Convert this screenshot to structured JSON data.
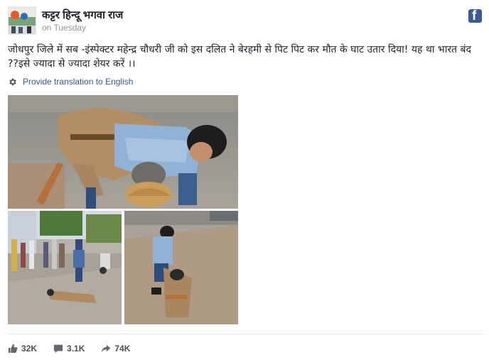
{
  "post": {
    "page_name": "कट्टर हिन्दू भगवा राज",
    "timestamp": "on Tuesday",
    "text": "जोधपुर जिले में सब -इंस्पेक्टर महेन्द्र चौधरी जी को इस दलित ने बेरहमी से पिट पिट कर मौत के घाट उतार दिया! यह था भारत बंद ??इसे ज्यादा से ज्यादा शेयर करें ।।",
    "translate_label": "Provide translation to English",
    "platform_icon": "facebook-logo-icon",
    "brand_color": "#3b5998",
    "link_color": "#365899"
  },
  "stats": {
    "likes": "32K",
    "comments": "3.1K",
    "shares": "74K"
  }
}
